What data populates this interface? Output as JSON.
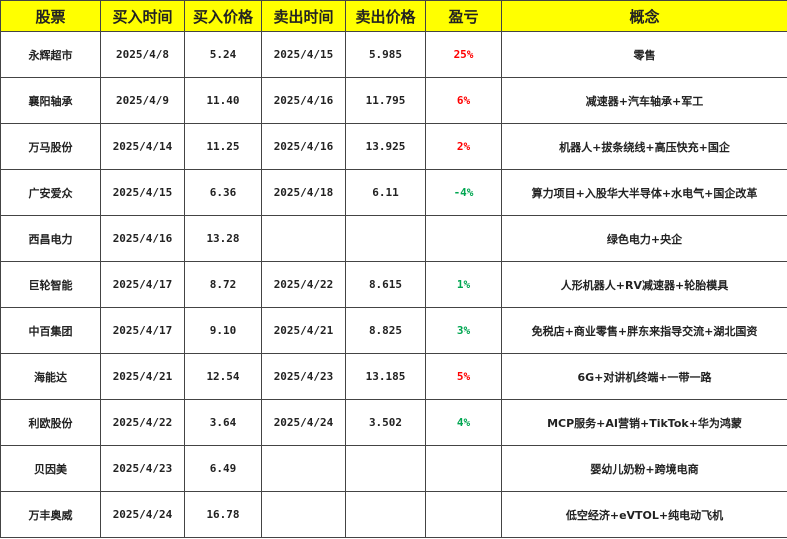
{
  "colors": {
    "header_bg": "#ffff00",
    "gain": "#ff0000",
    "loss": "#00a651"
  },
  "headers": [
    "股票",
    "买入时间",
    "买入价格",
    "卖出时间",
    "卖出价格",
    "盈亏",
    "概念"
  ],
  "rows": [
    {
      "name": "永辉超市",
      "buy_date": "2025/4/8",
      "buy_price": "5.24",
      "sell_date": "2025/4/15",
      "sell_price": "5.985",
      "pnl": "25%",
      "pnl_type": "pos",
      "concept": "零售"
    },
    {
      "name": "襄阳轴承",
      "buy_date": "2025/4/9",
      "buy_price": "11.40",
      "sell_date": "2025/4/16",
      "sell_price": "11.795",
      "pnl": "6%",
      "pnl_type": "pos",
      "concept": "减速器+汽车轴承+军工"
    },
    {
      "name": "万马股份",
      "buy_date": "2025/4/14",
      "buy_price": "11.25",
      "sell_date": "2025/4/16",
      "sell_price": "13.925",
      "pnl": "2%",
      "pnl_type": "pos",
      "concept": "机器人+拔条绕线+高压快充+国企"
    },
    {
      "name": "广安爱众",
      "buy_date": "2025/4/15",
      "buy_price": "6.36",
      "sell_date": "2025/4/18",
      "sell_price": "6.11",
      "pnl": "-4%",
      "pnl_type": "neg",
      "concept": "算力项目+入股华大半导体+水电气+国企改革"
    },
    {
      "name": "西昌电力",
      "buy_date": "2025/4/16",
      "buy_price": "13.28",
      "sell_date": "",
      "sell_price": "",
      "pnl": "",
      "pnl_type": "",
      "concept": "绿色电力+央企"
    },
    {
      "name": "巨轮智能",
      "buy_date": "2025/4/17",
      "buy_price": "8.72",
      "sell_date": "2025/4/22",
      "sell_price": "8.615",
      "pnl": "1%",
      "pnl_type": "neg",
      "concept": "人形机器人+RV减速器+轮胎模具"
    },
    {
      "name": "中百集团",
      "buy_date": "2025/4/17",
      "buy_price": "9.10",
      "sell_date": "2025/4/21",
      "sell_price": "8.825",
      "pnl": "3%",
      "pnl_type": "neg",
      "concept": "免税店+商业零售+胖东来指导交流+湖北国资"
    },
    {
      "name": "海能达",
      "buy_date": "2025/4/21",
      "buy_price": "12.54",
      "sell_date": "2025/4/23",
      "sell_price": "13.185",
      "pnl": "5%",
      "pnl_type": "pos",
      "concept": "6G+对讲机终端+一带一路"
    },
    {
      "name": "利欧股份",
      "buy_date": "2025/4/22",
      "buy_price": "3.64",
      "sell_date": "2025/4/24",
      "sell_price": "3.502",
      "pnl": "4%",
      "pnl_type": "neg",
      "concept": "MCP服务+AI营销+TikTok+华为鸿蒙"
    },
    {
      "name": "贝因美",
      "buy_date": "2025/4/23",
      "buy_price": "6.49",
      "sell_date": "",
      "sell_price": "",
      "pnl": "",
      "pnl_type": "",
      "concept": "婴幼儿奶粉+跨境电商"
    },
    {
      "name": "万丰奥威",
      "buy_date": "2025/4/24",
      "buy_price": "16.78",
      "sell_date": "",
      "sell_price": "",
      "pnl": "",
      "pnl_type": "",
      "concept": "低空经济+eVTOL+纯电动飞机"
    }
  ]
}
